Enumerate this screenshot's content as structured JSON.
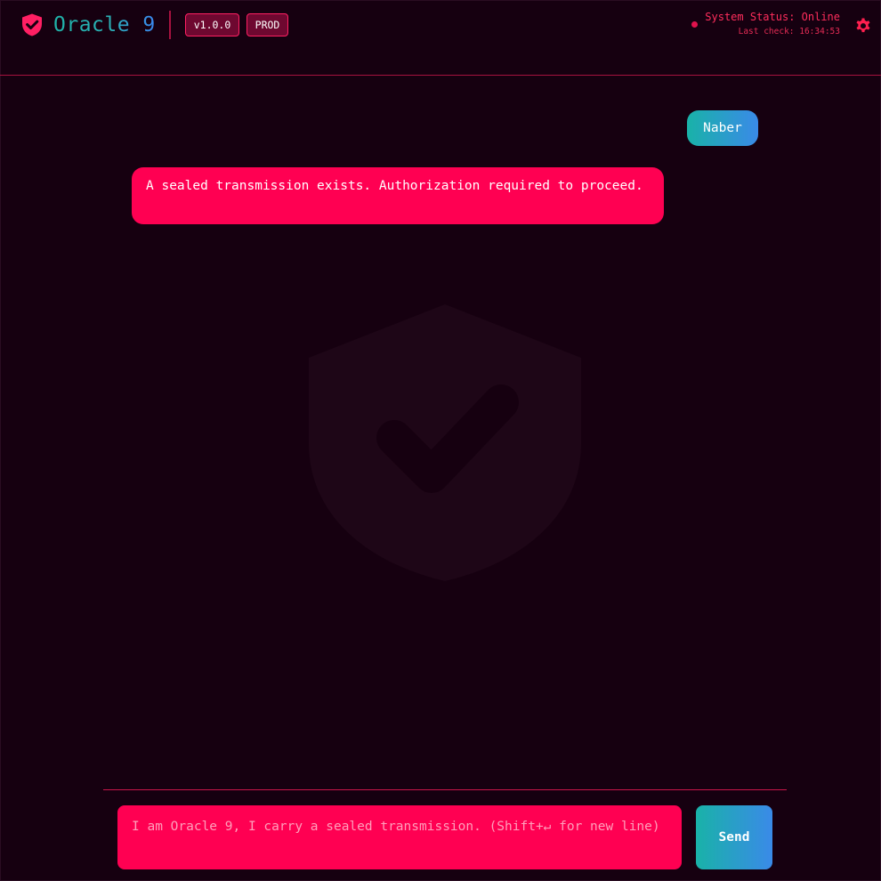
{
  "header": {
    "title": "Oracle 9",
    "version_badge": "v1.0.0",
    "env_badge": "PROD",
    "status_text": "System Status: Online",
    "last_check": "Last check: 16:34:53",
    "icons": {
      "logo": "shield-check-icon",
      "settings": "gear-icon"
    }
  },
  "messages": [
    {
      "role": "user",
      "text": "Naber"
    },
    {
      "role": "assistant",
      "text": "A sealed transmission exists. Authorization required to proceed."
    }
  ],
  "watermark": {
    "icon": "shield-check-icon"
  },
  "composer": {
    "placeholder": "I am Oracle 9, I carry a sealed transmission. (Shift+↵ for new line)",
    "value": "",
    "send_label": "Send"
  },
  "colors": {
    "background": "#160010",
    "accent": "#ff0052",
    "divider": "#a6123f",
    "gradient_start": "#19b2a8",
    "gradient_end": "#3a8ae8"
  }
}
